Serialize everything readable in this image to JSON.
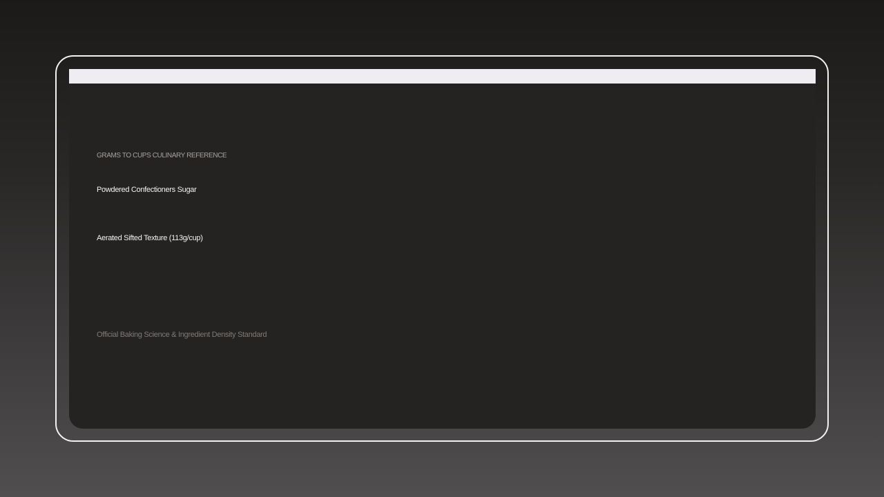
{
  "card": {
    "eyebrow": "GRAMS TO CUPS CULINARY REFERENCE",
    "product_name": "Powdered Confectioners Sugar",
    "texture_note": "Aerated Sifted Texture (113g/cup)",
    "footer": "Official Baking Science & Ingredient Density Standard"
  },
  "colors": {
    "frame_border": "#f2f2f2",
    "card_background": "#252322",
    "top_strip": "#efedf1",
    "primary_text": "#f4f2f0",
    "muted_text": "#a6a29f",
    "faint_text": "#7e7a77"
  }
}
